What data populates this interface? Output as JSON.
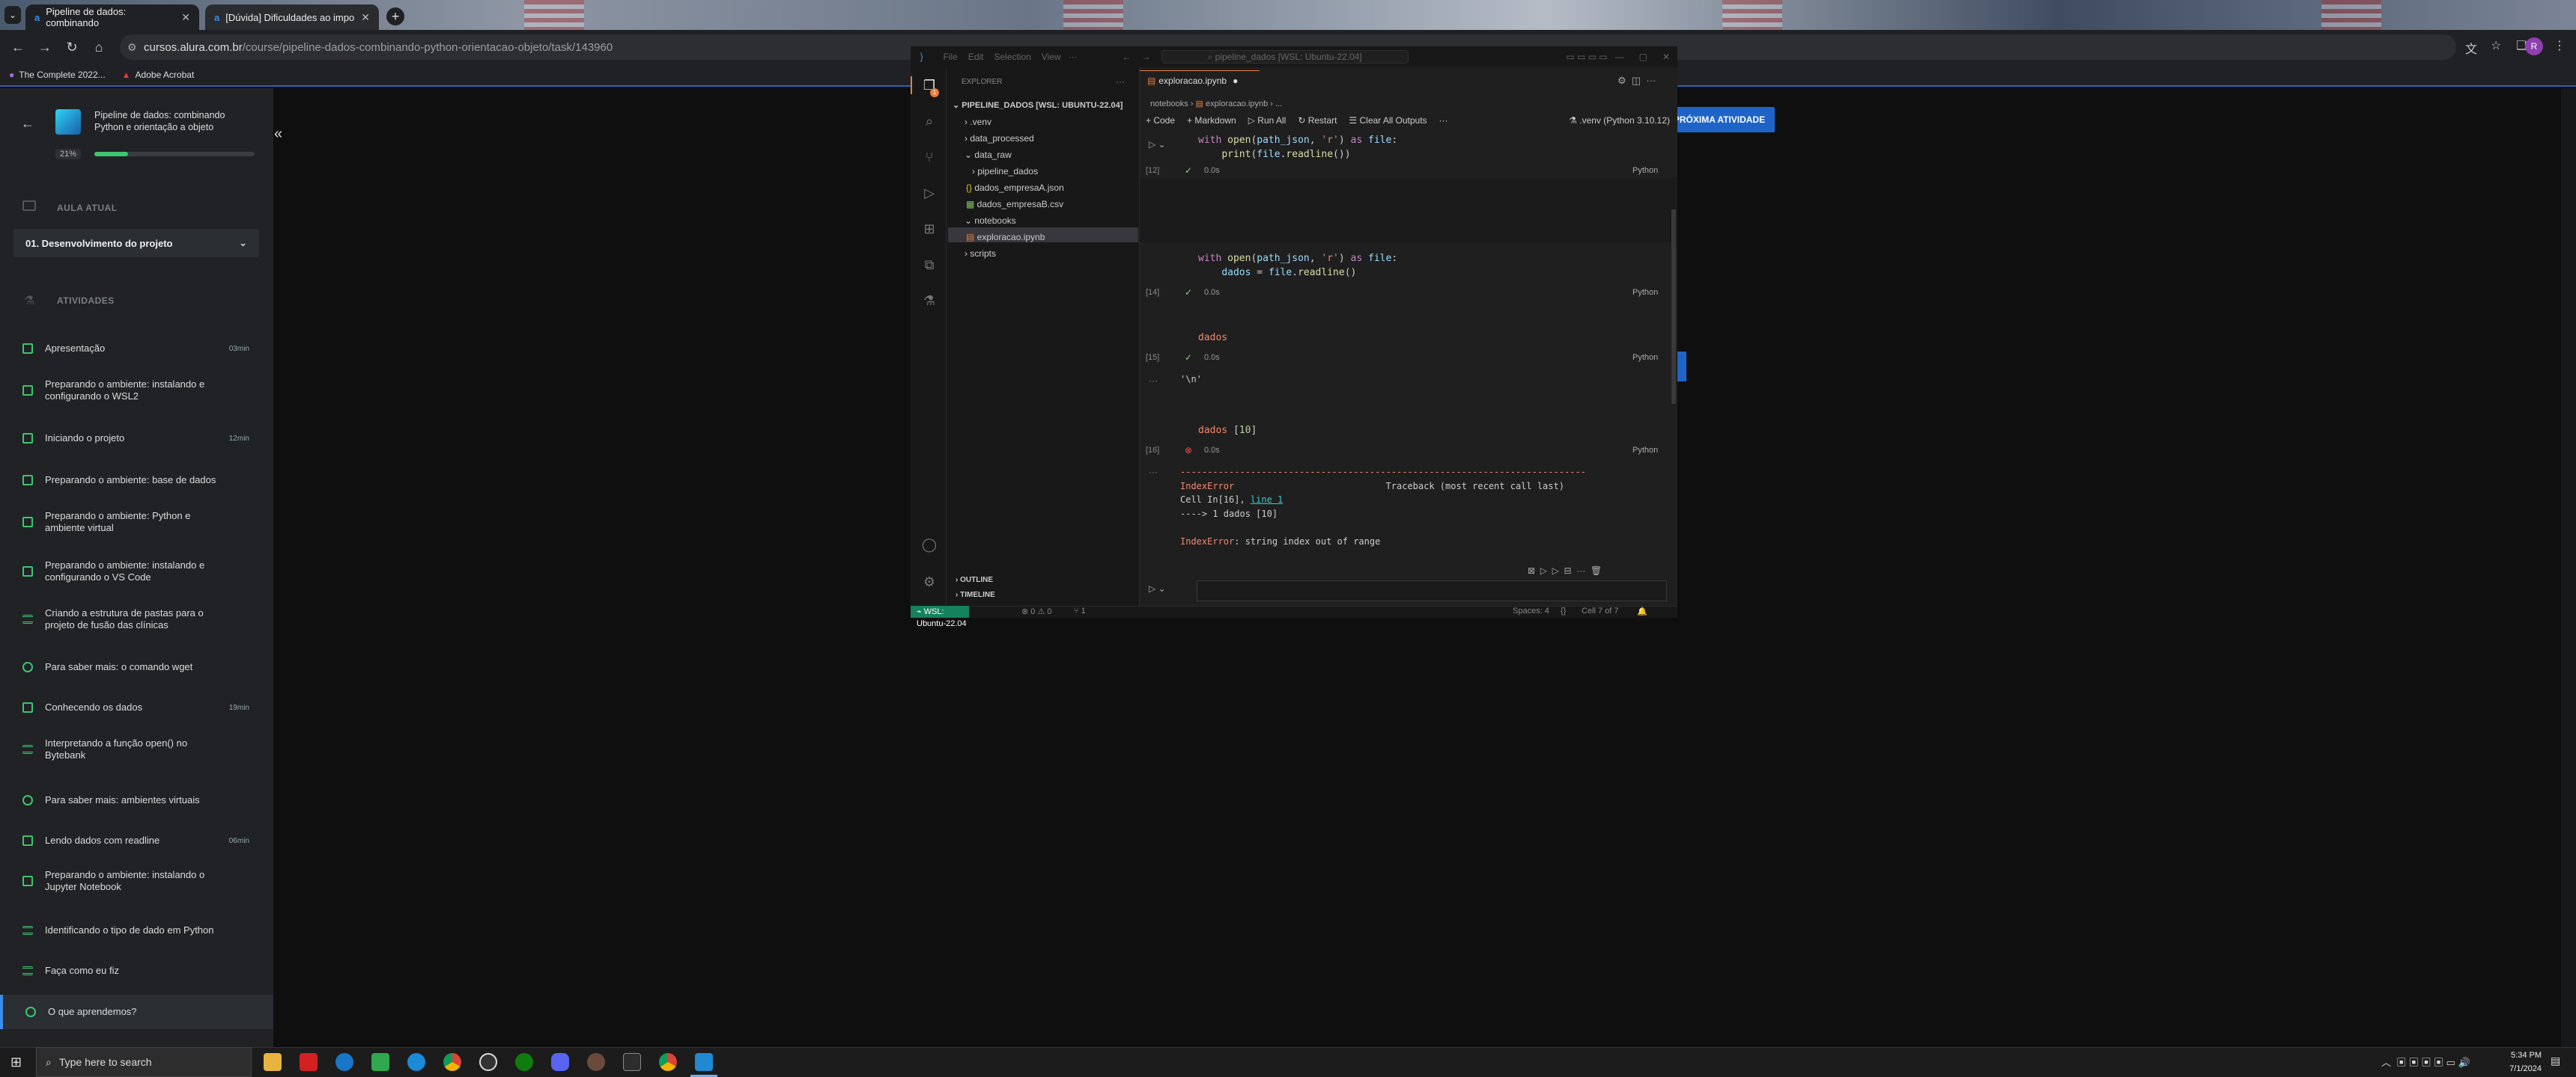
{
  "browser": {
    "tabs": [
      {
        "title": "Pipeline de dados: combinando"
      },
      {
        "title": "[Dúvida] Dificuldades ao impo"
      }
    ],
    "url_host": "cursos.alura.com.br",
    "url_path": "/course/pipeline-dados-combinando-python-orientacao-objeto/task/143960",
    "bookmarks": [
      "The Complete 2022...",
      "Adobe Acrobat"
    ],
    "profile_initial": "R"
  },
  "course": {
    "title": "Pipeline de dados: combinando Python e orientação a objeto",
    "progress_label": "21%",
    "progress_value": 0.21,
    "current_lesson_label": "AULA ATUAL",
    "module": "01. Desenvolvimento do projeto",
    "activities_label": "ATIVIDADES",
    "activities": [
      {
        "title": "Apresentação",
        "duration": "03min",
        "icon": "video-icon"
      },
      {
        "title": "Preparando o ambiente: instalando e configurando o WSL2",
        "duration": "",
        "icon": "doc-icon"
      },
      {
        "title": "Iniciando o projeto",
        "duration": "12min",
        "icon": "video-icon"
      },
      {
        "title": "Preparando o ambiente: base de dados",
        "duration": "",
        "icon": "doc-icon"
      },
      {
        "title": "Preparando o ambiente: Python e ambiente virtual",
        "duration": "",
        "icon": "doc-icon"
      },
      {
        "title": "Preparando o ambiente: instalando e configurando o VS Code",
        "duration": "",
        "icon": "doc-icon"
      },
      {
        "title": "Criando a estrutura de pastas para o projeto de fusão das clínicas",
        "duration": "",
        "icon": "list-icon"
      },
      {
        "title": "Para saber mais: o comando wget",
        "duration": "",
        "icon": "plus-circle-icon"
      },
      {
        "title": "Conhecendo os dados",
        "duration": "19min",
        "icon": "video-icon"
      },
      {
        "title": "Interpretando a função open() no Bytebank",
        "duration": "",
        "icon": "list-icon"
      },
      {
        "title": "Para saber mais: ambientes virtuais",
        "duration": "",
        "icon": "plus-circle-icon"
      },
      {
        "title": "Lendo dados com readline",
        "duration": "06min",
        "icon": "video-icon"
      },
      {
        "title": "Preparando o ambiente: instalando o Jupyter Notebook",
        "duration": "",
        "icon": "doc-icon"
      },
      {
        "title": "Identificando o tipo de dado em Python",
        "duration": "",
        "icon": "list-icon"
      },
      {
        "title": "Faça como eu fiz",
        "duration": "",
        "icon": "code-icon"
      },
      {
        "title": "O que aprendemos?",
        "duration": "",
        "icon": "person-icon"
      }
    ],
    "next_button": "PRÓXIMA ATIVIDADE"
  },
  "vscode": {
    "menu": [
      "File",
      "Edit",
      "Selection",
      "View"
    ],
    "search": "pipeline_dados [WSL: Ubuntu-22.04]",
    "explorer_header": "EXPLORER",
    "root": "PIPELINE_DADOS [WSL: UBUNTU-22.04]",
    "tree": [
      ".venv",
      "data_processed",
      "data_raw",
      "pipeline_dados",
      "dados_empresaA.json",
      "dados_empresaB.csv",
      "notebooks",
      "exploracao.ipynb",
      "scripts"
    ],
    "outline": "OUTLINE",
    "timeline": "TIMELINE",
    "tab": "exploracao.ipynb",
    "breadcrumb": [
      "notebooks",
      "exploracao.ipynb",
      "..."
    ],
    "toolbar": [
      "Code",
      "Markdown",
      "Run All",
      "Restart",
      "Clear All Outputs"
    ],
    "kernel": ".venv (Python 3.10.12)",
    "cells": [
      {
        "exec": "[12]",
        "time": "0.0s",
        "lang": "Python"
      },
      {
        "exec": "[14]",
        "time": "0.0s",
        "lang": "Python"
      },
      {
        "exec": "[15]",
        "time": "0.0s",
        "lang": "Python",
        "output": "'\\n'"
      },
      {
        "exec": "[16]",
        "time": "0.0s",
        "lang": "Python"
      }
    ],
    "error": {
      "dashes": "---------------------------------------------------------------------------",
      "name": "IndexError",
      "traceback": "Traceback (most recent call last)",
      "cell_prefix": "Cell In[16], ",
      "cell_link": "line 1",
      "arrow": "----> 1 dados [10]",
      "message": ": string index out of range"
    },
    "status": {
      "wsl": "WSL: Ubuntu-22.04",
      "problems": "⊗ 0 ⚠ 0",
      "ports": "⑂ 1",
      "spaces": "Spaces: 4",
      "cell": "Cell 7 of 7"
    }
  },
  "taskbar": {
    "search_placeholder": "Type here to search",
    "time": "5:34 PM",
    "date": "7/1/2024"
  }
}
